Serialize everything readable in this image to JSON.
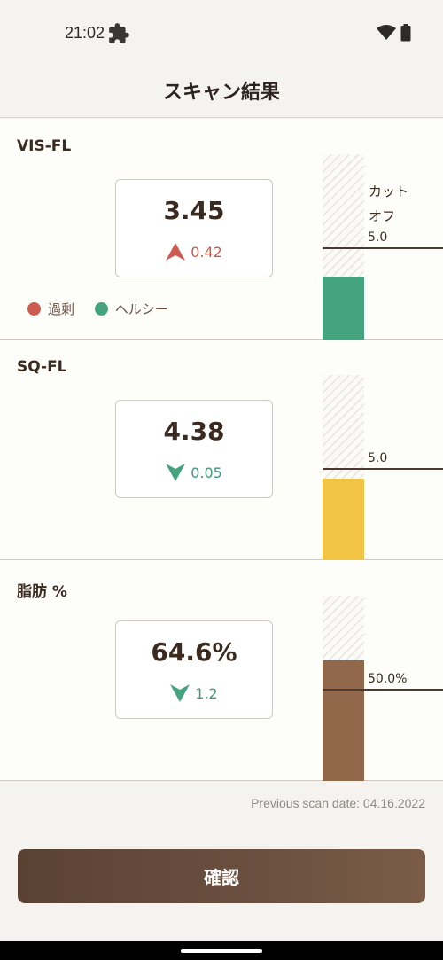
{
  "status_bar": {
    "time": "21:02"
  },
  "header": {
    "title": "スキャン結果"
  },
  "colors": {
    "excess": "#cc5b50",
    "healthy": "#46a37f",
    "yellow": "#f2c443",
    "brown": "#91684a"
  },
  "sections": [
    {
      "title": "VIS-FL",
      "value": "3.45",
      "delta": "0.42",
      "delta_direction": "up",
      "cutoff_label": "カットオフ",
      "cutoff_value": "5.0",
      "fill_fraction": 0.34,
      "cutoff_fraction": 0.5
    },
    {
      "title": "SQ-FL",
      "value": "4.38",
      "delta": "0.05",
      "delta_direction": "down",
      "cutoff_value": "5.0",
      "fill_fraction": 0.44,
      "cutoff_fraction": 0.5
    },
    {
      "title": "脂肪 %",
      "value": "64.6%",
      "delta": "1.2",
      "delta_direction": "down",
      "cutoff_value": "50.0%",
      "fill_fraction": 0.65,
      "cutoff_fraction": 0.5
    }
  ],
  "legend": [
    {
      "label": "過剰",
      "color": "#cc5b50"
    },
    {
      "label": "ヘルシー",
      "color": "#46a37f"
    }
  ],
  "previous_scan": "Previous scan date: 04.16.2022",
  "confirm_label": "確認"
}
